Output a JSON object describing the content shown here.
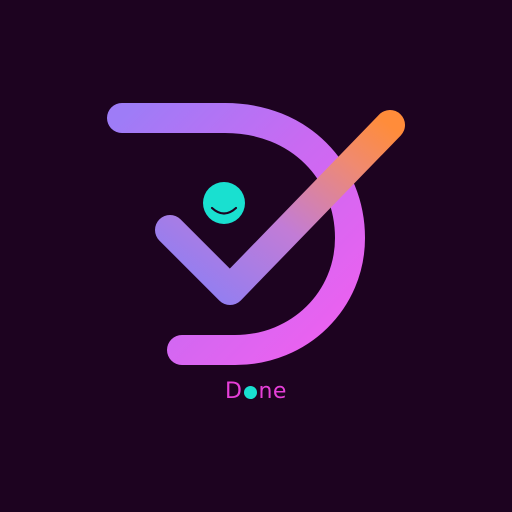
{
  "brand": {
    "wordmark_first": "D",
    "wordmark_rest": "ne",
    "wordmark_dot_represents": "o"
  },
  "colors": {
    "background": "#1d0320",
    "d_blue": "#4d7de6",
    "d_magenta": "#e85cf2",
    "check_orange": "#ff8c3a",
    "smiley_teal": "#19e0d0",
    "wordmark": "#e63fd8"
  },
  "icons": [
    "letter-d-mark",
    "checkmark-icon",
    "smiley-face-icon"
  ]
}
